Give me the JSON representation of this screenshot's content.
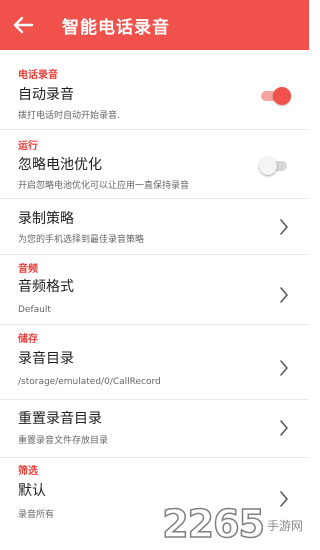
{
  "appbar": {
    "title": "智能电话录音",
    "back_icon": "arrow-left-icon",
    "background": "#f0514b"
  },
  "sections": [
    {
      "header": "电话录音",
      "items": [
        {
          "label": "自动录音",
          "desc": "拨打电话时自动开始录音.",
          "control": "toggle",
          "toggle_on": true
        }
      ]
    },
    {
      "header": "运行",
      "items": [
        {
          "label": "忽略电池优化",
          "desc": "开启忽略电池优化可以让应用一直保持录音",
          "control": "toggle",
          "toggle_on": false
        }
      ]
    },
    {
      "header": "",
      "items": [
        {
          "label": "录制策略",
          "desc": "为您的手机选择到最佳录音策略",
          "control": "chevron"
        }
      ]
    },
    {
      "header": "音频",
      "items": [
        {
          "label": "音频格式",
          "desc": "Default",
          "control": "chevron"
        }
      ]
    },
    {
      "header": "储存",
      "items": [
        {
          "label": "录音目录",
          "desc": "/storage/emulated/0/CallRecord",
          "control": "chevron"
        },
        {
          "label": "重置录音目录",
          "desc": "重置录音文件存放目录",
          "control": "chevron"
        }
      ]
    },
    {
      "header": "筛选",
      "items": [
        {
          "label": "默认",
          "desc": "录音所有",
          "control": "chevron"
        }
      ]
    }
  ],
  "watermark": {
    "number": "2265",
    "site": "手游网"
  },
  "colors": {
    "accent": "#f0514b",
    "section_header": "#e5433d",
    "divider": "#e8e8e8"
  }
}
